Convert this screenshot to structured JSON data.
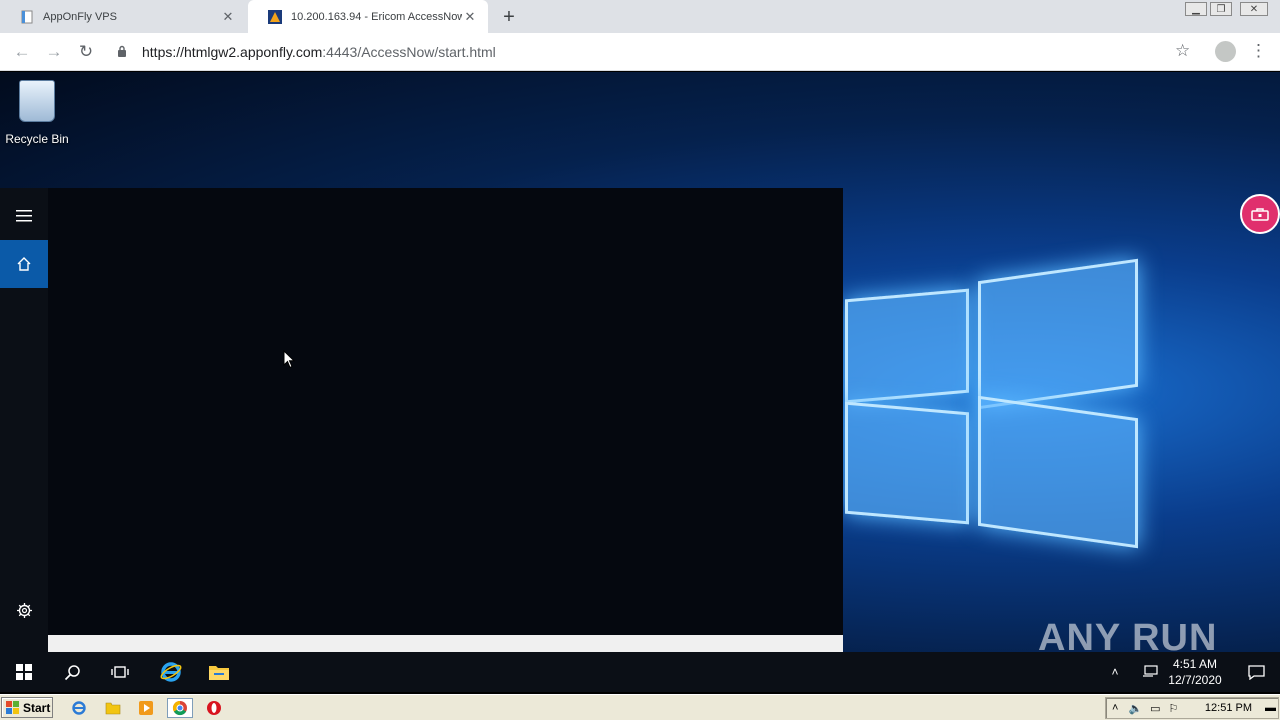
{
  "browser": {
    "tabs": [
      {
        "title": "AppOnFly VPS",
        "active": false
      },
      {
        "title": "10.200.163.94 - Ericom AccessNow",
        "active": true
      }
    ],
    "new_tab": "+",
    "url_host": "https://htmlgw2.apponfly.com",
    "url_rest": ":4443/AccessNow/start.html",
    "window_controls": [
      "minimize",
      "restore",
      "close"
    ]
  },
  "desktop": {
    "icons": [
      {
        "label": "Recycle Bin",
        "icon": "recycle-bin-icon"
      }
    ],
    "start_menu": {
      "rail": [
        "hamburger-menu-icon",
        "home-icon",
        "settings-icon"
      ],
      "state": "open-empty"
    },
    "watermark": "ANY RUN",
    "colors": {
      "wallpaper_accent": "#1a6fd0",
      "start_highlight": "#0b5aa8",
      "toolbox": "#e0306d"
    }
  },
  "win_taskbar": {
    "buttons": [
      "windows-start-icon",
      "search-icon",
      "task-view-icon",
      "internet-explorer-icon",
      "file-explorer-icon"
    ],
    "time": "4:51 AM",
    "date": "12/7/2020"
  },
  "host_taskbar": {
    "start_label": "Start",
    "quicklaunch": [
      "internet-explorer-icon",
      "folder-icon",
      "media-player-icon",
      "chrome-icon",
      "opera-icon"
    ],
    "clock": "12:51 PM"
  }
}
